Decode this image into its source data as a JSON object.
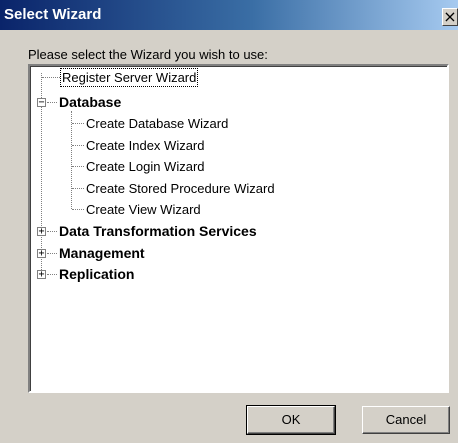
{
  "window": {
    "title": "Select Wizard",
    "close_glyph": "×",
    "titlebar_colors": [
      "#0a246a",
      "#3a6ea5",
      "#a6caf0"
    ]
  },
  "prompt": "Please select the Wizard you wish to use:",
  "tree": {
    "register": "Register Server Wizard",
    "database": {
      "label": "Database",
      "expander": "−",
      "children": [
        "Create Database Wizard",
        "Create Index Wizard",
        "Create Login Wizard",
        "Create Stored Procedure Wizard",
        "Create View Wizard"
      ]
    },
    "dts": {
      "label": "Data Transformation Services",
      "expander": "+"
    },
    "management": {
      "label": "Management",
      "expander": "+"
    },
    "replication": {
      "label": "Replication",
      "expander": "+"
    }
  },
  "buttons": {
    "ok": "OK",
    "cancel": "Cancel"
  }
}
